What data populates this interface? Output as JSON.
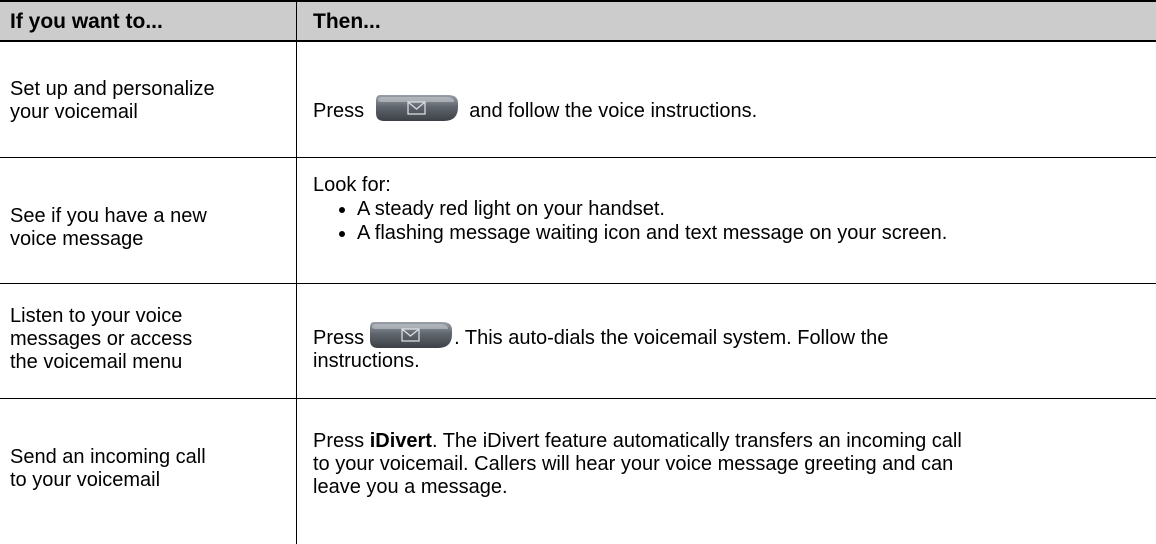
{
  "header": {
    "col1": "If you want to...",
    "col2": "Then..."
  },
  "rows": [
    {
      "left_line1": "Set up and personalize",
      "left_line2": "your voicemail",
      "right_pre": "Press",
      "right_post": "and follow the voice instructions."
    },
    {
      "left_line1": "See if you have a new",
      "left_line2": "voice message",
      "right_intro": "Look for:",
      "bullets": [
        "A steady red light on your handset.",
        "A flashing message waiting icon and text message on your screen."
      ]
    },
    {
      "left_line1": "Listen to your voice",
      "left_line2": "messages or access",
      "left_line3": "the voicemail menu",
      "right_pre": "Press",
      "right_post": ". This auto-dials the voicemail system.  Follow the",
      "right_line2": "instructions."
    },
    {
      "left_line1": "Send an incoming call",
      "left_line2": "to your voicemail",
      "right_pre": "Press",
      "right_bold": "iDivert",
      "right_line1_rest": ". The iDivert feature automatically transfers an incoming call",
      "right_line2": "to your voicemail. Callers will hear your voice message greeting and can",
      "right_line3": "leave you a message."
    }
  ],
  "icons": {
    "messages_button": "messages-envelope-icon"
  }
}
